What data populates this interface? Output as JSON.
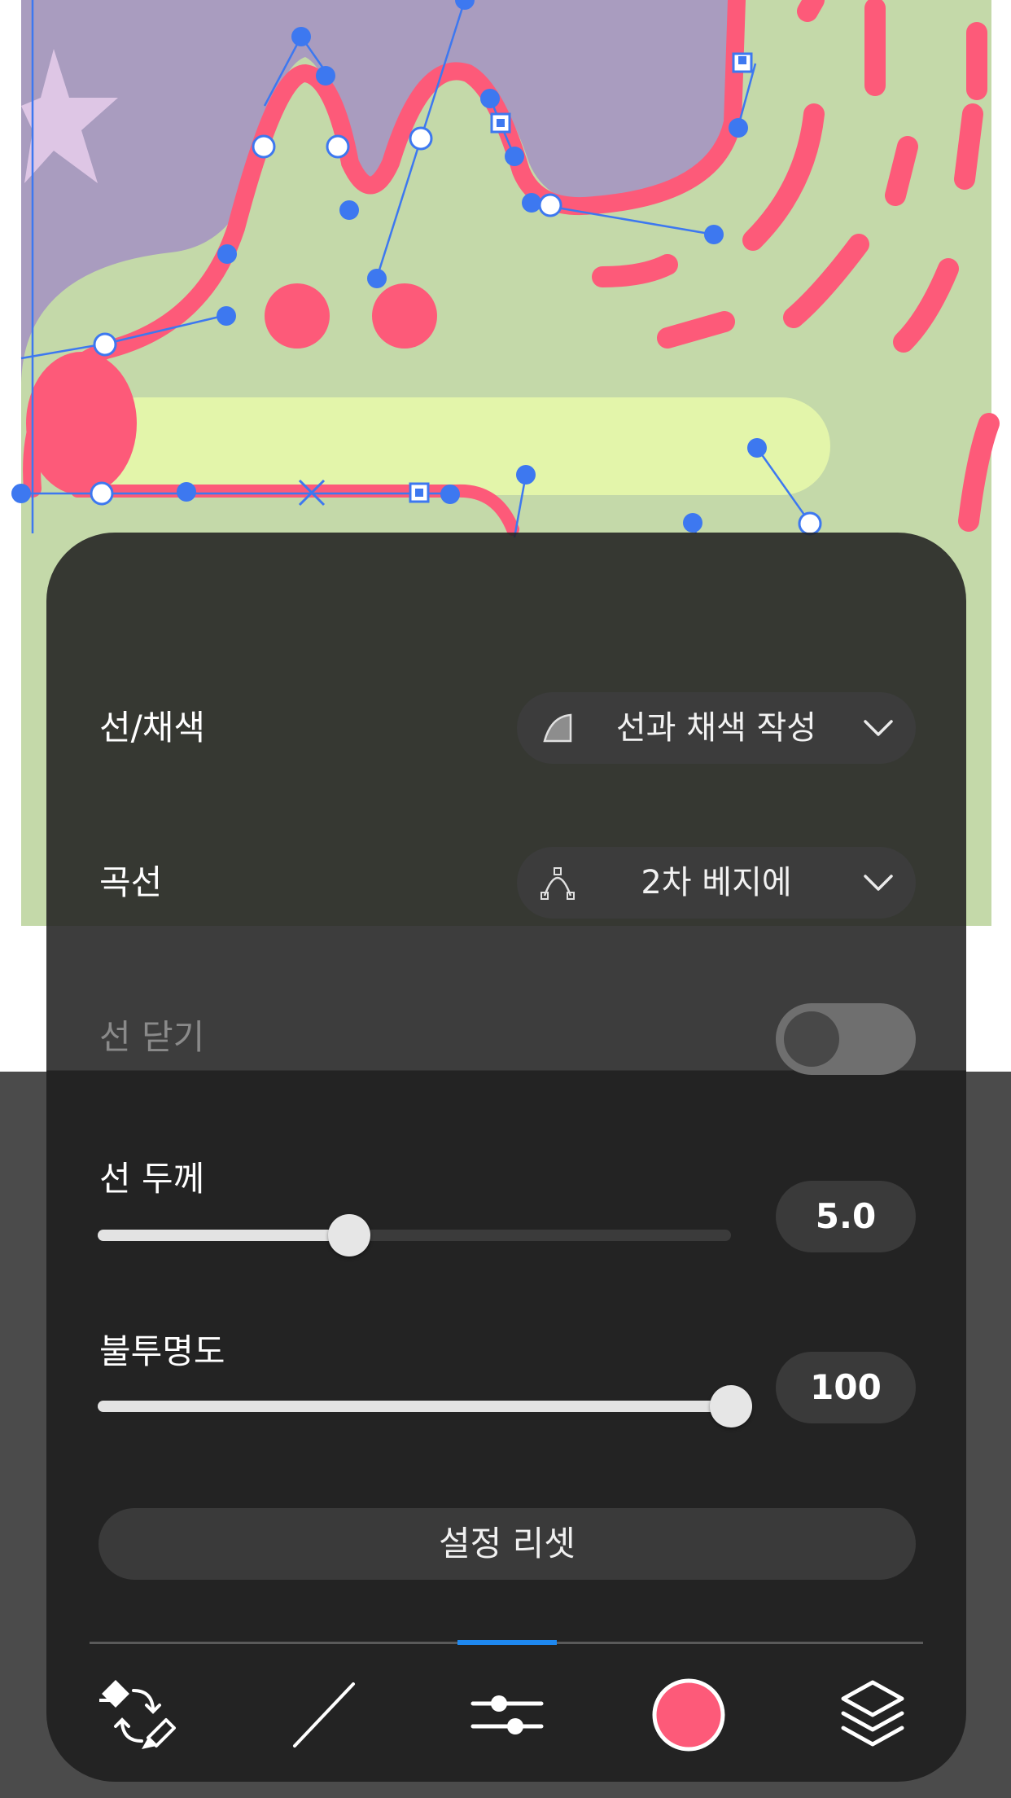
{
  "panel": {
    "stroke_fill": {
      "label": "선/채색",
      "value": "선과 채색 작성",
      "icon": "stroke-fill-icon"
    },
    "curve": {
      "label": "곡선",
      "value": "2차 베지에",
      "icon": "bezier-curve-icon"
    },
    "close_line": {
      "label": "선 닫기",
      "enabled": false
    },
    "thickness": {
      "label": "선 두께",
      "value": "5.0",
      "level": 0.397
    },
    "opacity": {
      "label": "불투명도",
      "value": "100",
      "level": 1.0
    },
    "reset_label": "설정 리셋"
  },
  "toolbar": {
    "tools": [
      "eraser-brush-swap-icon",
      "line-tool-icon",
      "settings-sliders-icon",
      "color-swatch",
      "layers-icon"
    ],
    "active_tab": "settings-sliders-icon",
    "current_color": "#fd5a79"
  },
  "colors": {
    "accent": "#1e88f0",
    "stroke_pink": "#fd5a79",
    "canvas_bg": "#a99cbf",
    "shape_green": "#c4d9a9",
    "anchor_blue": "#3d78f0"
  }
}
